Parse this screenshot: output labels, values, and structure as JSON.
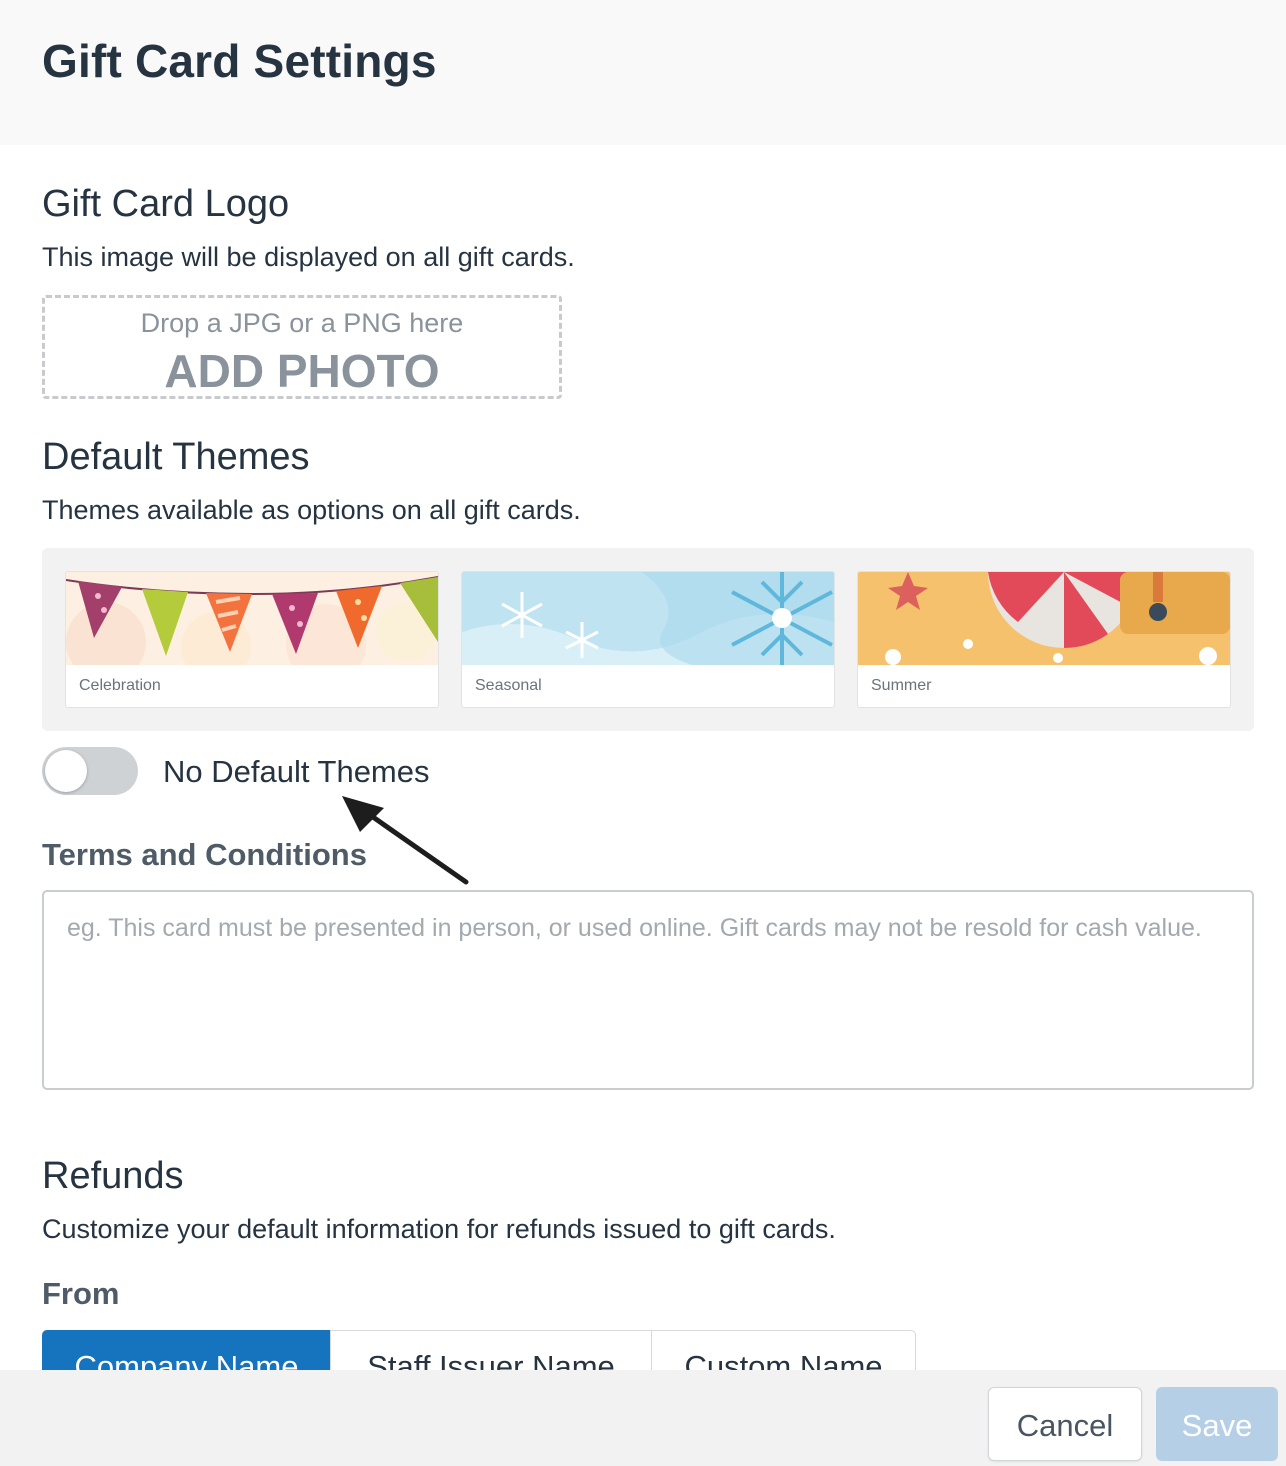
{
  "header": {
    "title": "Gift Card Settings"
  },
  "logo_section": {
    "title": "Gift Card Logo",
    "description": "This image will be displayed on all gift cards.",
    "dropzone_hint": "Drop a JPG or a PNG here",
    "dropzone_action": "ADD PHOTO"
  },
  "themes_section": {
    "title": "Default Themes",
    "description": "Themes available as options on all gift cards.",
    "themes": [
      {
        "label": "Celebration"
      },
      {
        "label": "Seasonal"
      },
      {
        "label": "Summer"
      }
    ],
    "toggle_label": "No Default Themes",
    "toggle_on": false
  },
  "terms": {
    "label": "Terms and Conditions",
    "placeholder": "eg. This card must be presented in person, or used online. Gift cards may not be resold for cash value.",
    "value": ""
  },
  "refunds": {
    "title": "Refunds",
    "description": "Customize your default information for refunds issued to gift cards.",
    "from_label": "From",
    "from_options": [
      "Company Name",
      "Staff Issuer Name",
      "Custom Name"
    ],
    "selected": "Company Name"
  },
  "footer": {
    "cancel_label": "Cancel",
    "save_label": "Save"
  },
  "colors": {
    "accent": "#1673be",
    "save_disabled": "#b5cfe7",
    "text": "#263341"
  }
}
